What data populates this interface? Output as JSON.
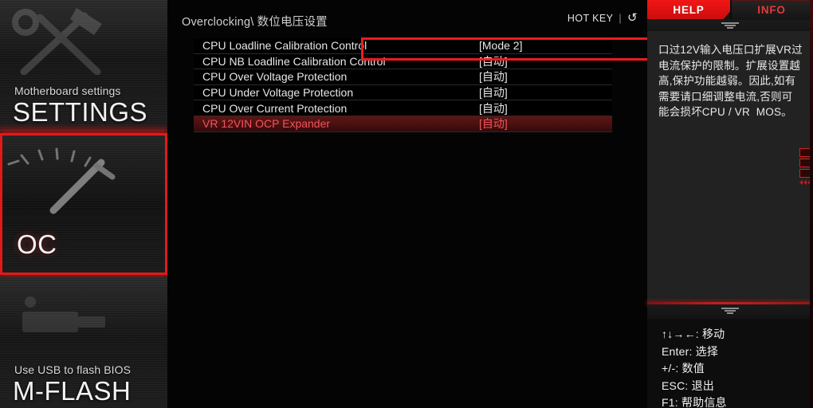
{
  "sidebar": {
    "panels": [
      {
        "sub": "Motherboard settings",
        "title": "SETTINGS",
        "icon": "tools-icon"
      },
      {
        "sub": "",
        "title": "OC",
        "icon": "gauge-icon"
      },
      {
        "sub": "Use USB to flash BIOS",
        "title": "M-FLASH",
        "icon": "usb-icon"
      }
    ]
  },
  "header": {
    "breadcrumb": "Overclocking\\ 数位电压设置",
    "hotkey_label": "HOT KEY",
    "hotkey_separator": "|",
    "refresh_icon": "↺"
  },
  "menu": {
    "rows": [
      {
        "label": "CPU Loadline Calibration Control",
        "value": "[Mode 2]",
        "selected": false,
        "annotated": true
      },
      {
        "label": "CPU NB Loadline Calibration Control",
        "value": "[自动]",
        "selected": false,
        "annotated": false
      },
      {
        "label": "CPU Over Voltage Protection",
        "value": "[自动]",
        "selected": false,
        "annotated": false
      },
      {
        "label": "CPU Under Voltage Protection",
        "value": "[自动]",
        "selected": false,
        "annotated": false
      },
      {
        "label": "CPU Over Current Protection",
        "value": "[自动]",
        "selected": false,
        "annotated": false
      },
      {
        "label": "VR 12VIN OCP Expander",
        "value": "[自动]",
        "selected": true,
        "annotated": false
      }
    ]
  },
  "right_panel": {
    "tabs": [
      {
        "label": "HELP",
        "active": true
      },
      {
        "label": "INFO",
        "active": false
      }
    ],
    "help_text": "口过12V输入电压口扩展VR过电流保护的限制。扩展设置越高,保护功能越弱。因此,如有需要请口细调整电流,否则可能会损坏CPU / VR  MOS。",
    "scroll_up_icon": "scroll-up-icon",
    "scroll_down_icon": "scroll-down-icon",
    "legend": [
      "↑↓→←: 移动",
      "Enter: 选择",
      "+/-: 数值",
      "ESC: 退出",
      "F1: 帮助信息"
    ],
    "page_indicator_icon": "page-indicator-icon"
  },
  "colors": {
    "accent_red": "#e01a1a",
    "tab_active": "#f01616",
    "selected_row": "#5d1414",
    "selected_text": "#f0555c",
    "annotation": "#ef1b1b"
  }
}
